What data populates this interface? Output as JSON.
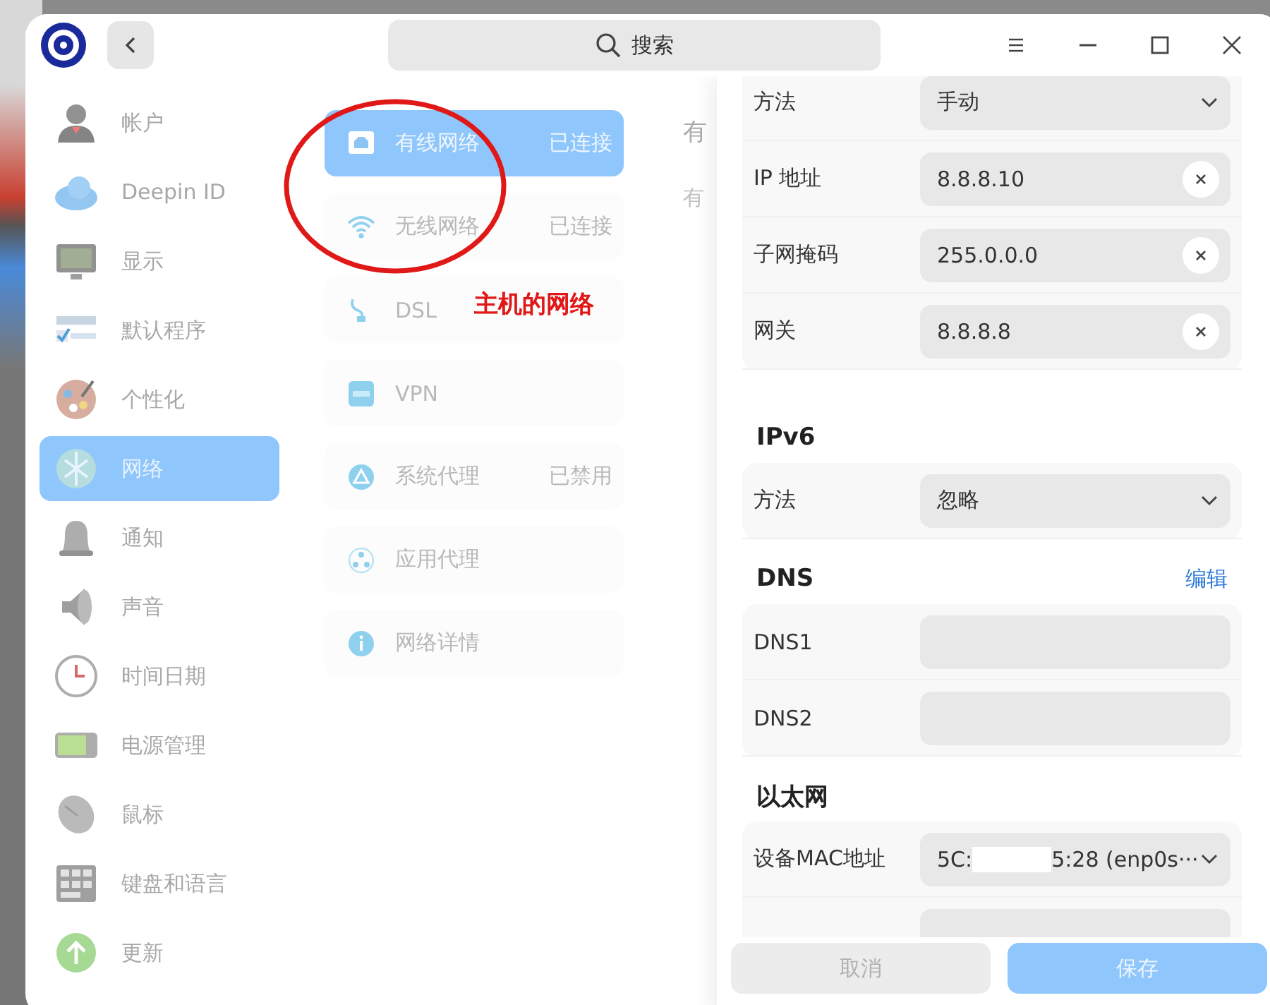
{
  "search": {
    "placeholder": "搜索"
  },
  "sidebar": {
    "items": [
      {
        "label": "帐户",
        "selected": false
      },
      {
        "label": "Deepin ID",
        "selected": false
      },
      {
        "label": "显示",
        "selected": false
      },
      {
        "label": "默认程序",
        "selected": false
      },
      {
        "label": "个性化",
        "selected": false
      },
      {
        "label": "网络",
        "selected": true
      },
      {
        "label": "通知",
        "selected": false
      },
      {
        "label": "声音",
        "selected": false
      },
      {
        "label": "时间日期",
        "selected": false
      },
      {
        "label": "电源管理",
        "selected": false
      },
      {
        "label": "鼠标",
        "selected": false
      },
      {
        "label": "键盘和语言",
        "selected": false
      },
      {
        "label": "更新",
        "selected": false
      }
    ]
  },
  "network_menu": {
    "items": [
      {
        "label": "有线网络",
        "status": "已连接",
        "selected": true
      },
      {
        "label": "无线网络",
        "status": "已连接",
        "selected": false
      },
      {
        "label": "DSL",
        "selected": false
      },
      {
        "label": "VPN",
        "selected": false
      },
      {
        "label": "系统代理",
        "status": "已禁用",
        "selected": false
      },
      {
        "label": "应用代理",
        "selected": false
      },
      {
        "label": "网络详情",
        "selected": false
      }
    ]
  },
  "annotation": {
    "text": "主机的网络"
  },
  "hidden_column": {
    "texts": [
      "有",
      "有"
    ]
  },
  "detail": {
    "sections": [
      {
        "rows": [
          {
            "kind": "select",
            "label": "方法",
            "value": "手动"
          },
          {
            "kind": "text",
            "label": "IP 地址",
            "value": "8.8.8.10"
          },
          {
            "kind": "text",
            "label": "子网掩码",
            "value": "255.0.0.0"
          },
          {
            "kind": "text",
            "label": "网关",
            "value": "8.8.8.8"
          }
        ]
      },
      {
        "title": "IPv6",
        "rows": [
          {
            "kind": "select",
            "label": "方法",
            "value": "忽略"
          }
        ]
      },
      {
        "title": "DNS",
        "action": "编辑",
        "rows": [
          {
            "kind": "input",
            "label": "DNS1"
          },
          {
            "kind": "input",
            "label": "DNS2"
          }
        ]
      },
      {
        "title": "以太网",
        "rows": [
          {
            "kind": "select",
            "label": "设备MAC地址",
            "value": "5C:",
            "value_tail": "5:28 (enp0s···"
          },
          {
            "kind": "input"
          }
        ]
      }
    ]
  },
  "footer": {
    "buttons": [
      {
        "label": "取消",
        "kind": "secondary"
      },
      {
        "label": "保存",
        "kind": "primary"
      }
    ]
  }
}
